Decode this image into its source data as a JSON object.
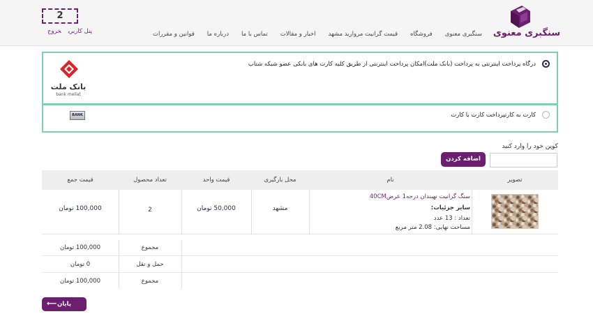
{
  "header": {
    "brand": "سنگبری معنوی",
    "nav": [
      "سنگبری معنوی",
      "فروشگاه",
      "قیمت گرانیت مروارید مشهد",
      "اخبار و مقالات",
      "تماس با ما",
      "درباره ما",
      "قوانین و مقررات"
    ],
    "cart_count": "2",
    "user_panel": "پنل کاربری",
    "logout": "خروج"
  },
  "payment": {
    "mellat_text": "درگاه پرداخت اینترنتی به پرداخت (بانک ملت)امکان پرداخت اینترنتی از طریق کلیه کارت های بانکی عضو شبکه شتاب",
    "mellat_logo_fa": "بانک ملت",
    "mellat_logo_en": "bank mellat",
    "card_text": "کارت به کارتپرداخت کارت با کارت",
    "bank_icon_text": "BANK"
  },
  "coupon": {
    "label": "کوپن خود را وارد کنید",
    "button": "اضافه کردن"
  },
  "table": {
    "headers": {
      "image": "تصویر",
      "name": "نام",
      "location": "محل بارگیری",
      "unit_price": "قیمت واحد",
      "quantity": "تعداد محصول",
      "total": "قیمت جمع"
    },
    "row": {
      "name": "سنگ گرانیت نهبندان درجه1 عرض40CM",
      "details_title": "سایر جزئیات:",
      "count": "تعداد : 13 عدد",
      "area": "مساحت نهایی: 2.08 متر مربع",
      "location": "مشهد",
      "unit_price": "50,000 تومان",
      "quantity": "2",
      "total": "100,000 تومان"
    }
  },
  "summary": [
    {
      "label": "مجموع",
      "value": "100,000 تومان"
    },
    {
      "label": "حمل و نقل",
      "value": "0 تومان"
    },
    {
      "label": "مجموع",
      "value": "100,000 تومان"
    }
  ],
  "finish_button": "پایان",
  "colors": {
    "accent": "#6b1f6e",
    "border": "#7fcfb1"
  }
}
